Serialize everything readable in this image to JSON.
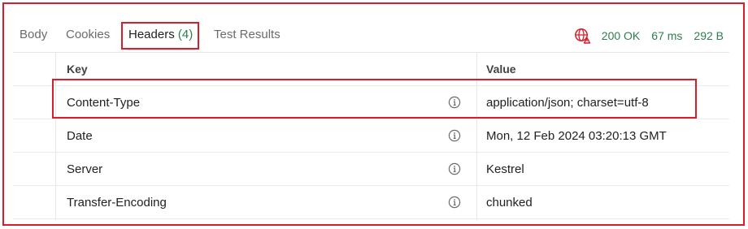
{
  "tabs": [
    {
      "label": "Body",
      "count": ""
    },
    {
      "label": "Cookies",
      "count": ""
    },
    {
      "label": "Headers",
      "count": "(4)"
    },
    {
      "label": "Test Results",
      "count": ""
    }
  ],
  "status": {
    "code": "200 OK",
    "time": "67 ms",
    "size": "292 B",
    "icon": "globe-warning-icon",
    "accent_color": "#2e7d4f",
    "highlight_color": "#d81e2a"
  },
  "table": {
    "columns": [
      "Key",
      "Value"
    ],
    "rows": [
      {
        "key": "Content-Type",
        "value": "application/json; charset=utf-8",
        "icon": "info-icon"
      },
      {
        "key": "Date",
        "value": "Mon, 12 Feb 2024 03:20:13 GMT",
        "icon": "info-icon"
      },
      {
        "key": "Server",
        "value": "Kestrel",
        "icon": "info-icon"
      },
      {
        "key": "Transfer-Encoding",
        "value": "chunked",
        "icon": "info-icon"
      }
    ]
  }
}
